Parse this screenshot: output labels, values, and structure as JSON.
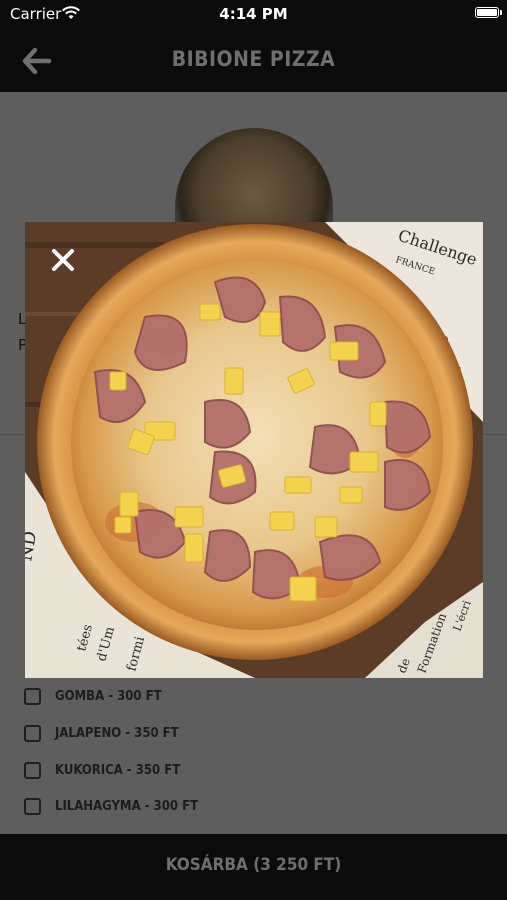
{
  "status_bar": {
    "carrier": "Carrier",
    "time": "4:14 PM"
  },
  "navbar": {
    "title": "BIBIONE PIZZA",
    "back_icon": "back-arrow-icon"
  },
  "content": {
    "line1": "L",
    "line2": "P"
  },
  "modal": {
    "close_icon": "close-icon",
    "newspaper_texts": [
      "Challenge",
      "FRANCE",
      "ormat",
      "ND",
      "tées",
      "d'Um",
      "formi",
      "L'écri",
      "Formation",
      "de"
    ]
  },
  "options": [
    {
      "label": "GOMBA - 300 FT",
      "checked": false
    },
    {
      "label": "JALAPENO - 350 FT",
      "checked": false
    },
    {
      "label": "KUKORICA - 350 FT",
      "checked": false
    },
    {
      "label": "LILAHAGYMA - 300 FT",
      "checked": false
    }
  ],
  "bottom_bar": {
    "cart_label": "KOSÁRBA (3 250 FT)"
  },
  "colors": {
    "bar_bg": "#0b0b0b",
    "overlay_bg": "#5e5e5e",
    "muted_text": "#6f6f6f"
  }
}
